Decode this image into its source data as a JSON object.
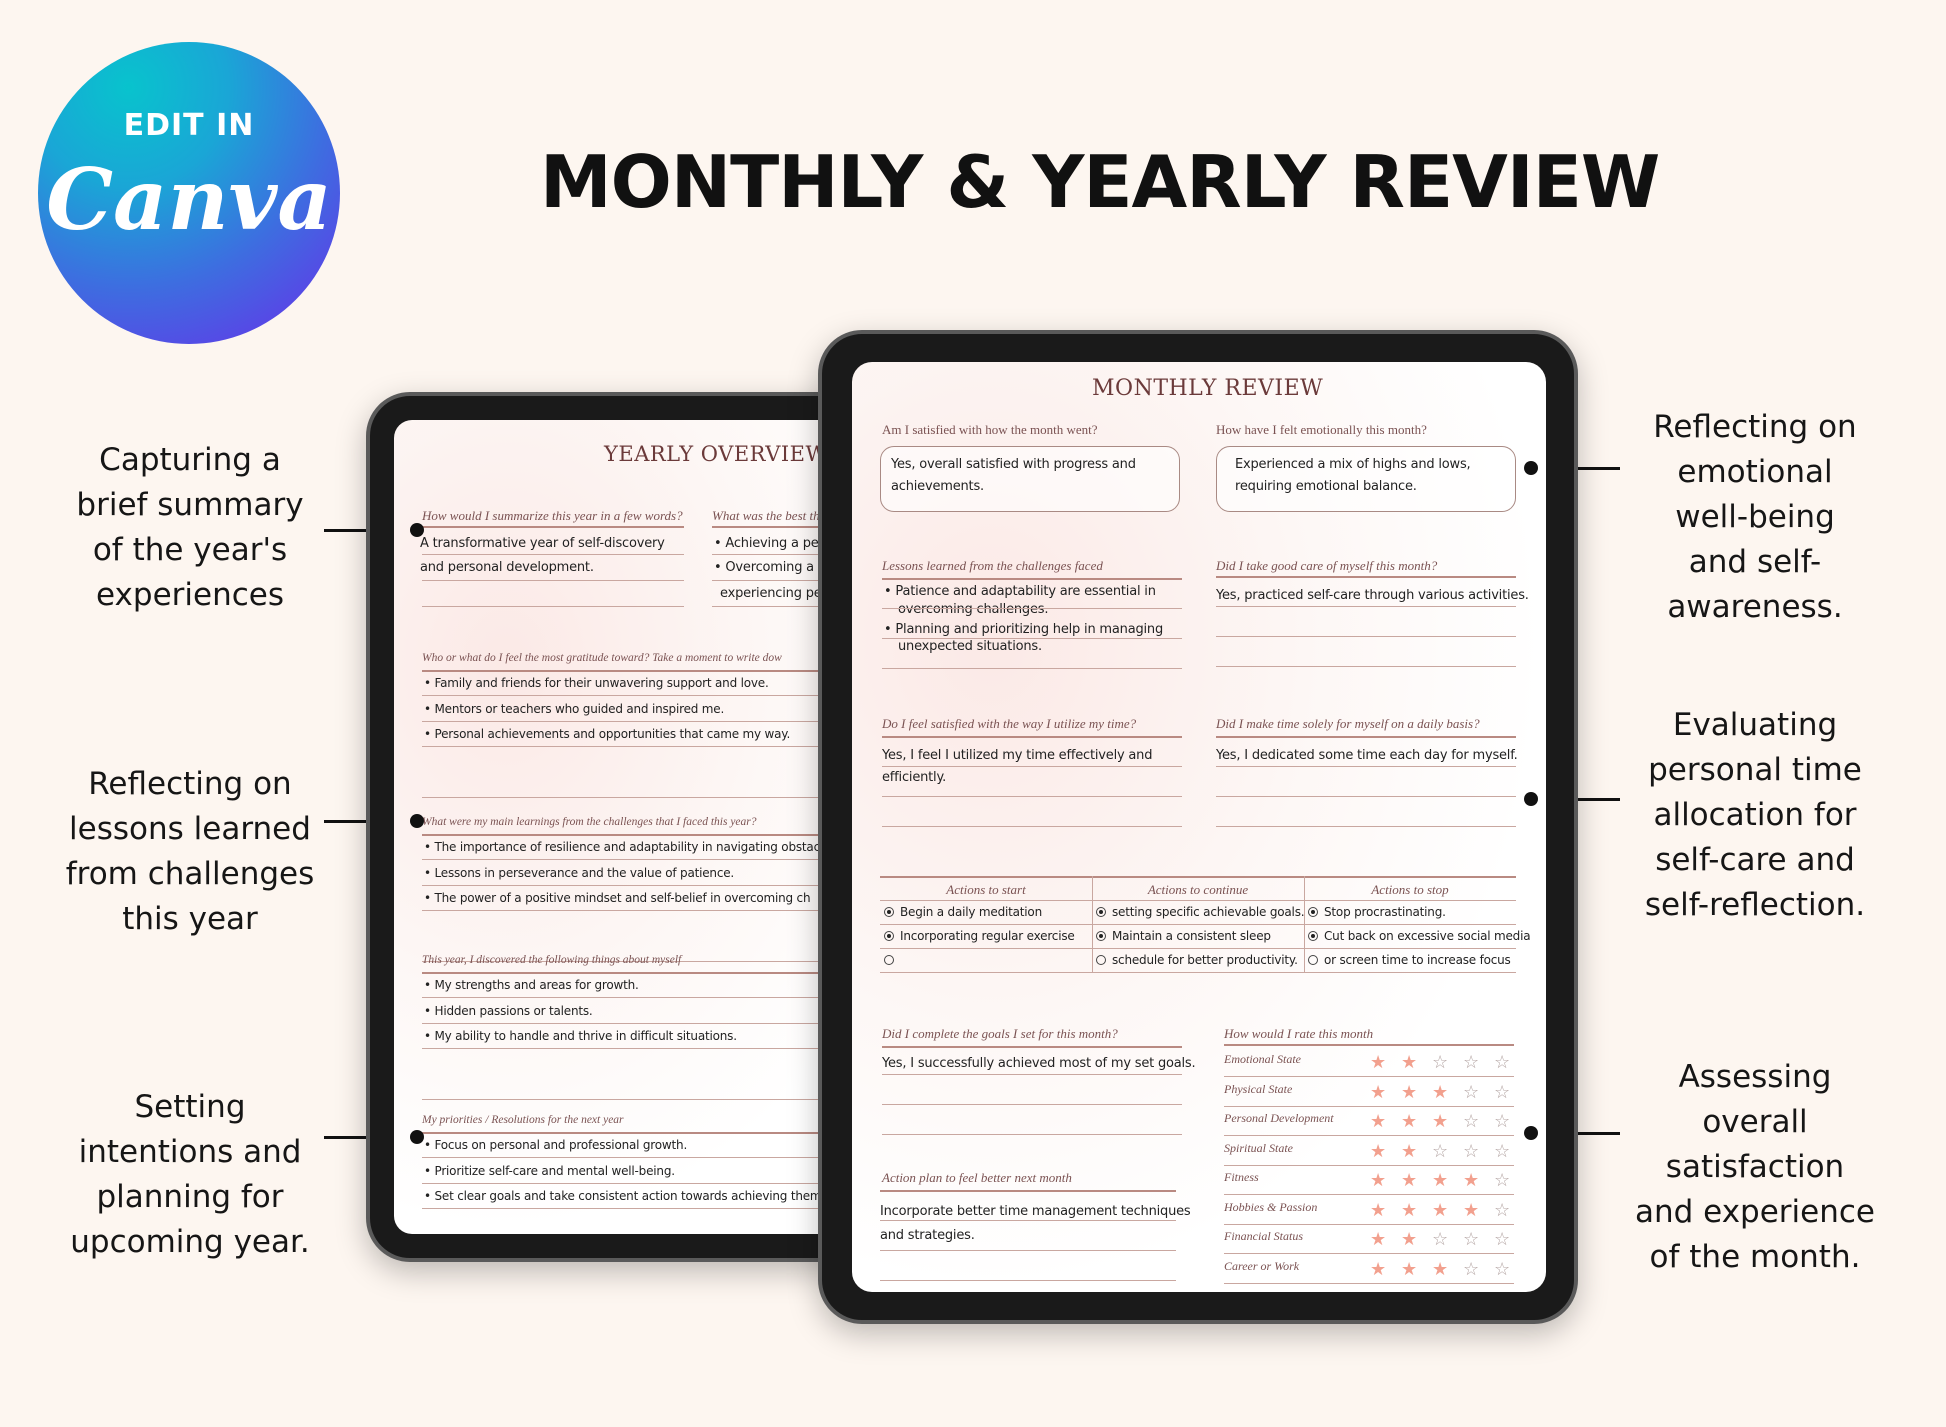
{
  "badge": {
    "line1": "EDIT IN",
    "line2": "Canva"
  },
  "title": "MONTHLY & YEARLY REVIEW",
  "annotations_left": [
    {
      "text": "Capturing a brief summary of the year's experiences",
      "lines": [
        "Capturing a",
        "brief summary",
        "of the year's",
        "experiences"
      ]
    },
    {
      "text": "Reflecting on lessons learned from challenges this year",
      "lines": [
        "Reflecting on",
        "lessons learned",
        "from challenges",
        "this year"
      ]
    },
    {
      "text": "Setting intentions and planning for upcoming year.",
      "lines": [
        "Setting",
        "intentions and",
        "planning for",
        "upcoming year."
      ]
    }
  ],
  "annotations_right": [
    {
      "lines": [
        "Reflecting on",
        "emotional",
        "well-being",
        "and self-",
        "awareness."
      ]
    },
    {
      "lines": [
        "Evaluating",
        "personal time",
        "allocation for",
        "self-care and",
        "self-reflection."
      ]
    },
    {
      "lines": [
        "Assessing",
        "overall",
        "satisfaction",
        "and experience",
        "of the month."
      ]
    }
  ],
  "yearly": {
    "title": "YEARLY OVERVIEW",
    "q1": "How would I summarize this year in a few words?",
    "a1": [
      "A transformative year of self-discovery",
      "and personal development."
    ],
    "q2": "What was the best th",
    "a2": [
      "• Achieving a per",
      "• Overcoming a m",
      "experiencing pers"
    ],
    "q3": "Who or what do I feel the most gratitude toward? Take a moment to write dow",
    "a3": [
      "Family and friends for their unwavering support and love.",
      "Mentors or teachers who guided and inspired me.",
      "Personal achievements and opportunities that came my way."
    ],
    "q4": "What were my main learnings from the challenges that I faced this year?",
    "a4": [
      "The importance of resilience and adaptability in navigating obstacles",
      "Lessons in perseverance and the value of patience.",
      "The power of a positive mindset and self-belief in overcoming ch"
    ],
    "q5": "This year, I discovered the following things about myself",
    "a5": [
      "My strengths and areas for growth.",
      "Hidden passions or talents.",
      "My ability to handle and thrive in difficult situations."
    ],
    "q6": "My priorities / Resolutions for the next year",
    "a6": [
      "Focus on personal and professional growth.",
      "Prioritize self-care and mental well-being.",
      "Set clear goals and take consistent action towards achieving them."
    ]
  },
  "monthly": {
    "title": "MONTHLY REVIEW",
    "q_satisfied": "Am I satisfied with how the month went?",
    "a_satisfied": [
      "Yes, overall satisfied with progress and",
      "achievements."
    ],
    "q_emotional": "How have I felt emotionally this month?",
    "a_emotional": [
      "Experienced a mix of highs and lows,",
      "requiring emotional balance."
    ],
    "q_lessons": "Lessons learned from the challenges faced",
    "a_lessons": [
      "• Patience and adaptability are essential in",
      "overcoming challenges.",
      "• Planning and prioritizing help in managing",
      "unexpected situations."
    ],
    "q_care": "Did I take good care of myself this month?",
    "a_care": "Yes, practiced self-care through various activities.",
    "q_time": "Do I feel satisfied with the way I utilize my time?",
    "a_time": [
      "Yes, I feel I utilized my time effectively and",
      "efficiently."
    ],
    "q_daily": "Did I make time solely for myself on a daily basis?",
    "a_daily": "Yes, I dedicated some time each day for myself.",
    "actions": {
      "headers": [
        "Actions to start",
        "Actions to continue",
        "Actions to stop"
      ],
      "rows": [
        [
          {
            "text": "Begin a daily meditation",
            "checked": true
          },
          {
            "text": "setting specific achievable goals.",
            "checked": true
          },
          {
            "text": "Stop procrastinating.",
            "checked": true
          }
        ],
        [
          {
            "text": "Incorporating regular exercise",
            "checked": true
          },
          {
            "text": "Maintain a consistent sleep",
            "checked": true
          },
          {
            "text": "Cut back on excessive social media",
            "checked": true
          }
        ],
        [
          {
            "text": "",
            "checked": false
          },
          {
            "text": "schedule for better productivity.",
            "checked": false
          },
          {
            "text": "or screen time to increase focus",
            "checked": false
          }
        ]
      ]
    },
    "q_goals": "Did I complete the goals I set for this month?",
    "a_goals": "Yes, I successfully achieved most of my set goals.",
    "q_plan": "Action plan to feel better next month",
    "a_plan": [
      "Incorporate better time management techniques",
      "and strategies."
    ],
    "rating_title": "How would I rate this month",
    "ratings": [
      {
        "label": "Emotional State",
        "stars": 2
      },
      {
        "label": "Physical State",
        "stars": 3
      },
      {
        "label": "Personal Development",
        "stars": 3
      },
      {
        "label": "Spiritual State",
        "stars": 2
      },
      {
        "label": "Fitness",
        "stars": 4
      },
      {
        "label": "Hobbies & Passion",
        "stars": 4
      },
      {
        "label": "Financial Status",
        "stars": 2
      },
      {
        "label": "Career or Work",
        "stars": 3
      }
    ],
    "max_stars": 5
  }
}
